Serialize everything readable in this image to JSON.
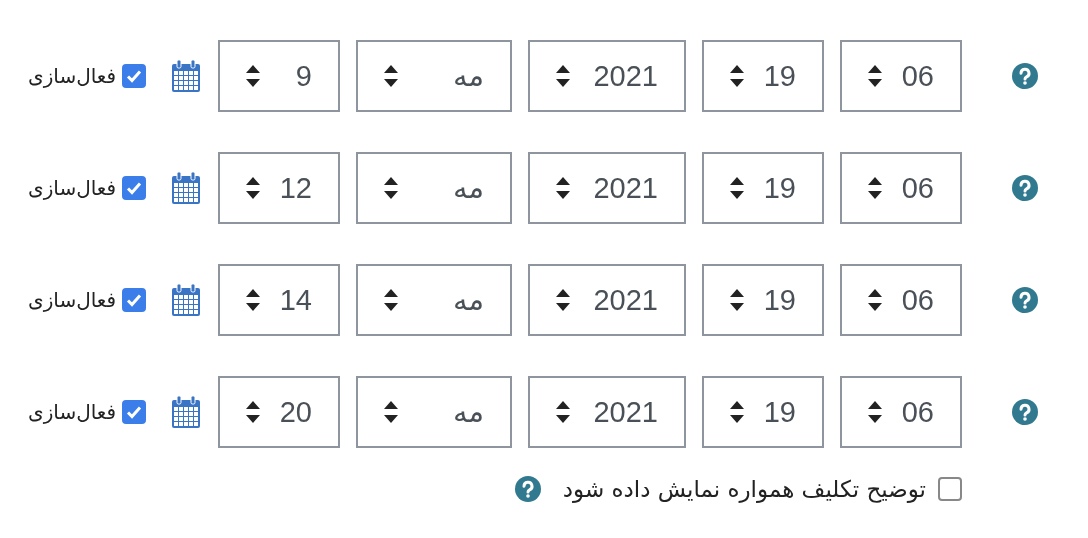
{
  "rows": [
    {
      "minute": "06",
      "hour": "19",
      "year": "2021",
      "month": "مه",
      "day": "9",
      "enabled": true,
      "enable_label": "فعال‌سازی"
    },
    {
      "minute": "06",
      "hour": "19",
      "year": "2021",
      "month": "مه",
      "day": "12",
      "enabled": true,
      "enable_label": "فعال‌سازی"
    },
    {
      "minute": "06",
      "hour": "19",
      "year": "2021",
      "month": "مه",
      "day": "14",
      "enabled": true,
      "enable_label": "فعال‌سازی"
    },
    {
      "minute": "06",
      "hour": "19",
      "year": "2021",
      "month": "مه",
      "day": "20",
      "enabled": true,
      "enable_label": "فعال‌سازی"
    }
  ],
  "always_show_description": {
    "checked": false,
    "label": "توضیح تکلیف همواره نمایش داده شود"
  }
}
